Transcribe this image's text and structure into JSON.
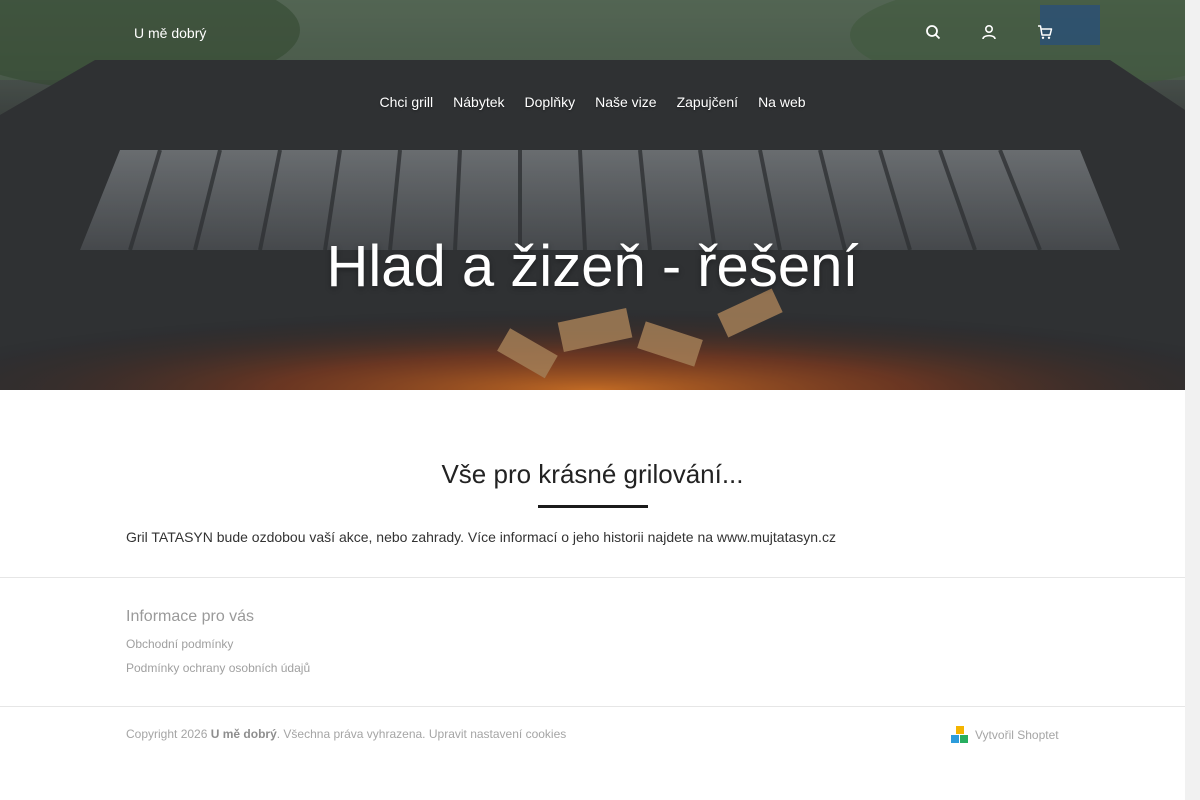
{
  "header": {
    "logo_text": "U mě dobrý",
    "icons": [
      "search-icon",
      "user-icon",
      "cart-icon"
    ]
  },
  "nav": {
    "items": [
      "Chci grill",
      "Nábytek",
      "Doplňky",
      "Naše vize",
      "Zapujčení",
      "Na web"
    ]
  },
  "hero": {
    "title": "Hlad a žizeň - řešení"
  },
  "main": {
    "section_title": "Vše pro krásné grilování...",
    "intro_text": "Gril TATASYN bude ozdobou vaší akce, nebo zahrady. Více informací o jeho historii najdete na www.mujtatasyn.cz"
  },
  "footer": {
    "info_heading": "Informace pro vás",
    "links": [
      "Obchodní podmínky",
      "Podmínky ochrany osobních údajů"
    ],
    "copyright_prefix": "Copyright 2026",
    "company": "U mě dobrý",
    "rights": ". Všechna práva vyhrazena.",
    "cookies_link": "Upravit nastavení cookies",
    "created_by": "Vytvořil Shoptet"
  },
  "colors": {
    "text_dark": "#222222",
    "footer_text": "#a5a5a5",
    "accent_line": "#1b1b1b"
  }
}
